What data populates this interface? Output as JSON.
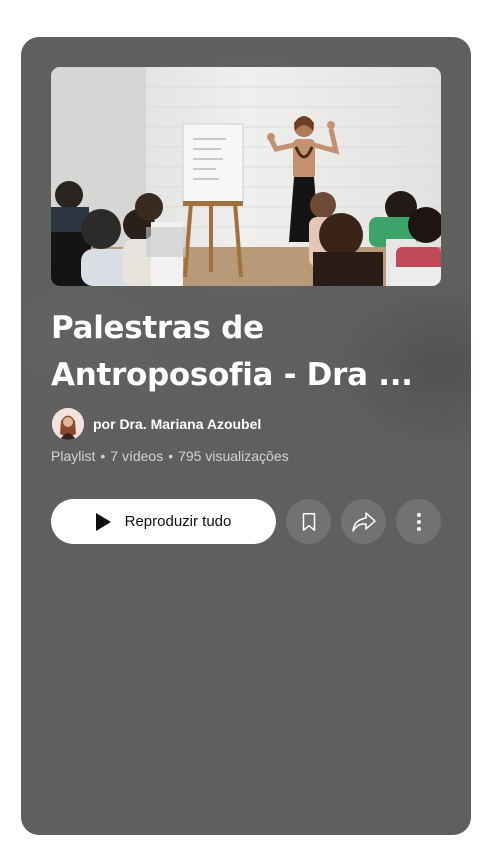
{
  "playlist": {
    "title": "Palestras de Antroposofia - Dra ...",
    "author": "por Dra. Mariana Azoubel",
    "meta": {
      "type": "Playlist",
      "videos": "7 vídeos",
      "views": "795 visualizações"
    },
    "thumbnail_icon": "lecture-photo"
  },
  "actions": {
    "play_all_label": "Reproduzir tudo",
    "play_icon": "play-icon",
    "save_icon": "bookmark-icon",
    "share_icon": "share-icon",
    "more_icon": "more-vert-icon"
  },
  "colors": {
    "card_bg": "#5f5f5f",
    "play_button_bg": "#ffffff",
    "text_primary": "#ffffff"
  }
}
